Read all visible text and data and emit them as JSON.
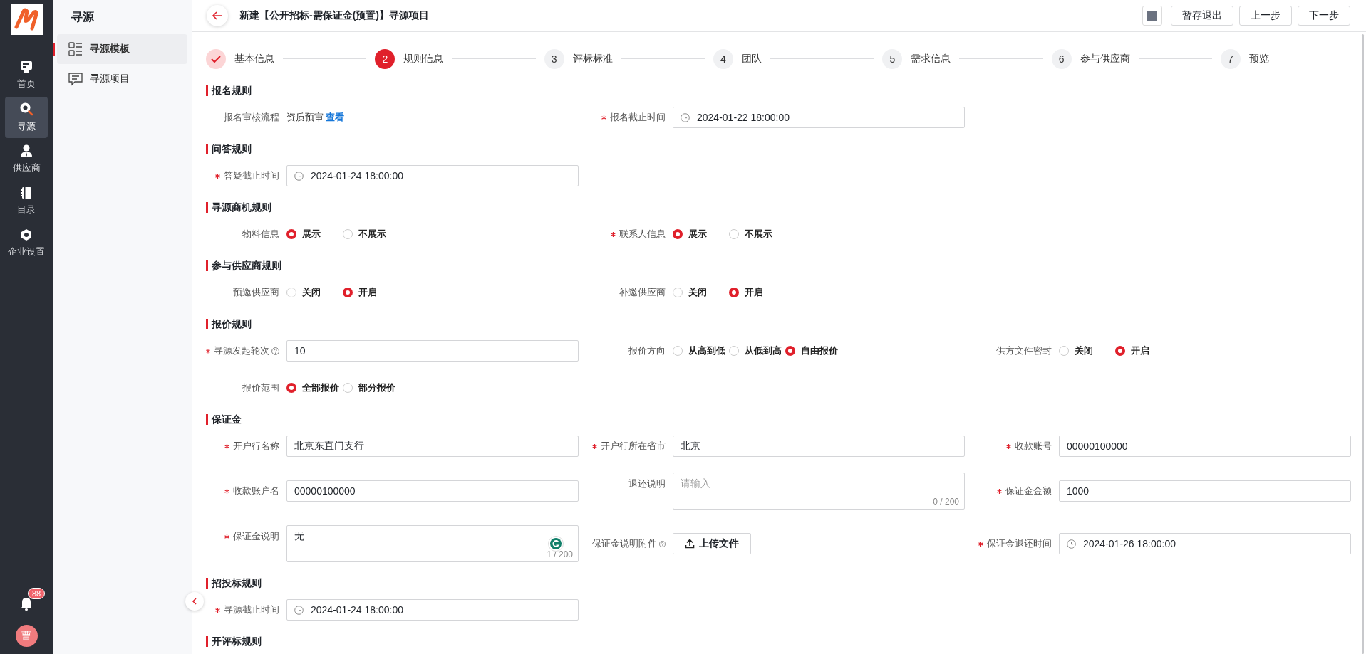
{
  "nav": {
    "items": [
      {
        "label": "首页",
        "selected": false
      },
      {
        "label": "寻源",
        "selected": true
      },
      {
        "label": "供应商",
        "selected": false
      },
      {
        "label": "目录",
        "selected": false
      },
      {
        "label": "企业设置",
        "selected": false
      }
    ],
    "notifications": "88",
    "avatar": "曹"
  },
  "subnav": {
    "title": "寻源",
    "items": [
      {
        "label": "寻源模板",
        "selected": true
      },
      {
        "label": "寻源项目",
        "selected": false
      }
    ]
  },
  "header": {
    "title": "新建【公开招标-需保证金(预置)】寻源项目",
    "buttons": [
      "暂存退出",
      "上一步",
      "下一步"
    ]
  },
  "steps": [
    {
      "label": "基本信息",
      "done": true,
      "selected": false
    },
    {
      "number": "2",
      "label": "规则信息",
      "done": false,
      "selected": true
    },
    {
      "number": "3",
      "label": "评标标准",
      "done": false,
      "selected": false
    },
    {
      "number": "4",
      "label": "团队",
      "done": false,
      "selected": false
    },
    {
      "number": "5",
      "label": "需求信息",
      "done": false,
      "selected": false
    },
    {
      "number": "6",
      "label": "参与供应商",
      "done": false,
      "selected": false
    },
    {
      "number": "7",
      "label": "预览",
      "done": false,
      "selected": false
    }
  ],
  "sections": [
    {
      "title": "报名规则",
      "rows": [
        [
          {
            "kind": "text",
            "label": "报名审核流程",
            "required": false,
            "value": "资质预审",
            "link": "查看"
          },
          {
            "kind": "date",
            "label": "报名截止时间",
            "required": true,
            "value": "2024-01-22 18:00:00"
          }
        ]
      ]
    },
    {
      "title": "问答规则",
      "rows": [
        [
          {
            "kind": "date",
            "label": "答疑截止时间",
            "required": true,
            "value": "2024-01-24 18:00:00"
          }
        ]
      ]
    },
    {
      "title": "寻源商机规则",
      "rows": [
        [
          {
            "kind": "radio",
            "label": "物料信息",
            "required": false,
            "options": [
              {
                "label": "展示",
                "selected": true
              },
              {
                "label": "不展示",
                "selected": false
              }
            ]
          },
          {
            "kind": "radio",
            "label": "联系人信息",
            "required": true,
            "options": [
              {
                "label": "展示",
                "selected": true
              },
              {
                "label": "不展示",
                "selected": false
              }
            ]
          }
        ]
      ]
    },
    {
      "title": "参与供应商规则",
      "rows": [
        [
          {
            "kind": "radio",
            "label": "预邀供应商",
            "required": false,
            "options": [
              {
                "label": "关闭",
                "selected": false
              },
              {
                "label": "开启",
                "selected": true
              }
            ]
          },
          {
            "kind": "radio",
            "label": "补邀供应商",
            "required": false,
            "options": [
              {
                "label": "关闭",
                "selected": false
              },
              {
                "label": "开启",
                "selected": true
              }
            ]
          }
        ]
      ]
    },
    {
      "title": "报价规则",
      "rows": [
        [
          {
            "kind": "input",
            "label": "寻源发起轮次",
            "required": true,
            "help": true,
            "value": "10"
          },
          {
            "kind": "radio",
            "label": "报价方向",
            "required": false,
            "options": [
              {
                "label": "从高到低",
                "selected": false
              },
              {
                "label": "从低到高",
                "selected": false
              },
              {
                "label": "自由报价",
                "selected": true
              }
            ]
          },
          {
            "kind": "radio",
            "label": "供方文件密封",
            "required": false,
            "options": [
              {
                "label": "关闭",
                "selected": false
              },
              {
                "label": "开启",
                "selected": true
              }
            ]
          }
        ],
        [
          {
            "kind": "radio",
            "label": "报价范围",
            "required": false,
            "options": [
              {
                "label": "全部报价",
                "selected": true
              },
              {
                "label": "部分报价",
                "selected": false
              }
            ]
          }
        ]
      ]
    },
    {
      "title": "保证金",
      "rows": [
        [
          {
            "kind": "input",
            "label": "开户行名称",
            "required": true,
            "value": "北京东直门支行"
          },
          {
            "kind": "input",
            "label": "开户行所在省市",
            "required": true,
            "value": "北京"
          },
          {
            "kind": "input",
            "label": "收款账号",
            "required": true,
            "value": "00000100000"
          }
        ],
        [
          {
            "kind": "input",
            "label": "收款账户名",
            "required": true,
            "value": "00000100000"
          },
          {
            "kind": "textarea",
            "label": "退还说明",
            "required": false,
            "placeholder": "请输入",
            "counter": "0 / 200"
          },
          {
            "kind": "input",
            "label": "保证金金额",
            "required": true,
            "value": "1000"
          }
        ],
        [
          {
            "kind": "textarea",
            "label": "保证金说明",
            "required": true,
            "value": "无",
            "counter": "1 / 200",
            "assistant_badge": true
          },
          {
            "kind": "upload",
            "label": "保证金说明附件",
            "required": false,
            "help": true,
            "button": "上传文件"
          },
          {
            "kind": "date",
            "label": "保证金退还时间",
            "required": true,
            "value": "2024-01-26 18:00:00"
          }
        ]
      ]
    },
    {
      "title": "招投标规则",
      "rows": [
        [
          {
            "kind": "date",
            "label": "寻源截止时间",
            "required": true,
            "value": "2024-01-24 18:00:00"
          }
        ]
      ]
    },
    {
      "title": "开评标规则"
    }
  ]
}
